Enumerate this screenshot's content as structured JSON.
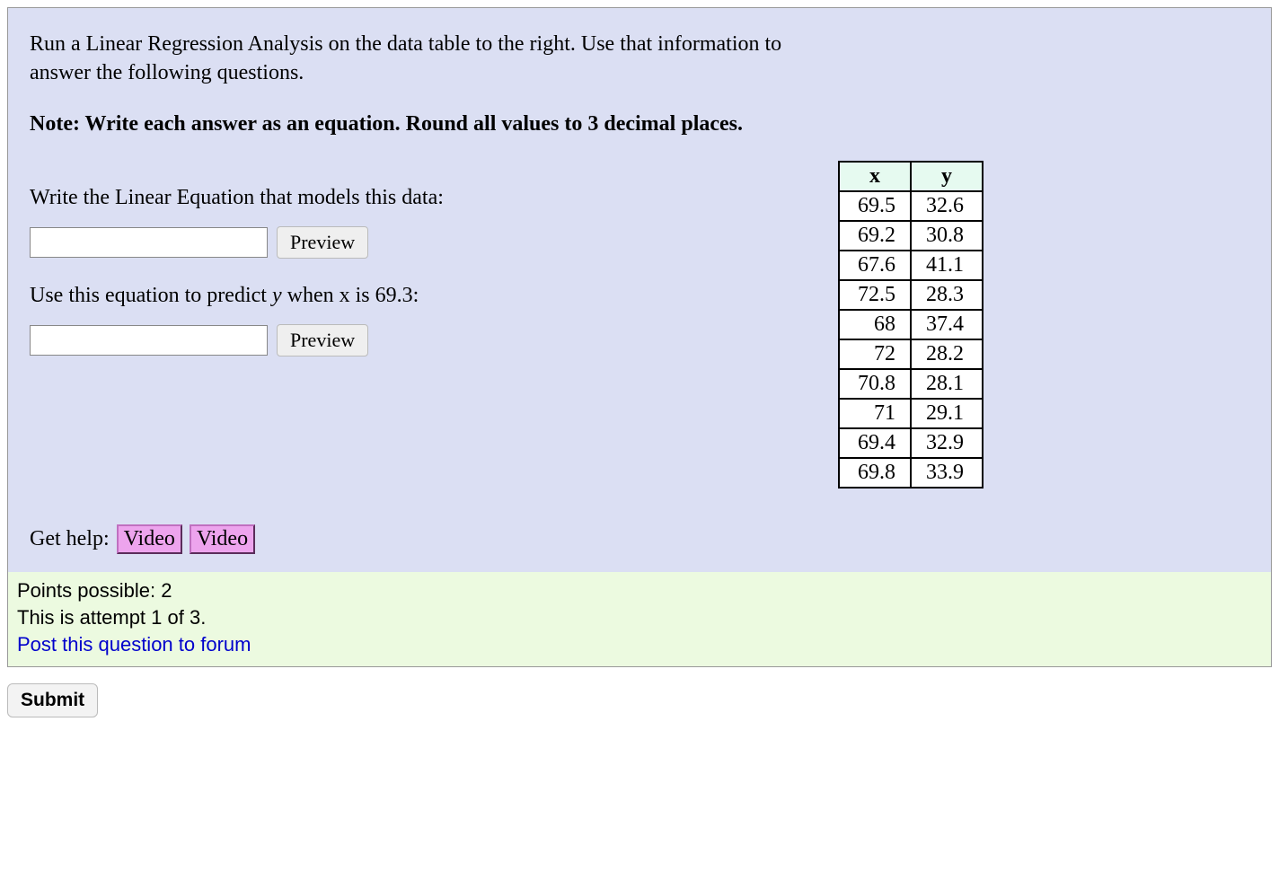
{
  "intro": "Run a Linear Regression Analysis on the data table to the right. Use that information to answer the following questions.",
  "note": "Note: Write each answer as an equation. Round all values to 3 decimal places.",
  "q1": {
    "prompt": "Write the Linear Equation that models this data:",
    "preview": "Preview"
  },
  "q2": {
    "prompt_pre": "Use this equation to predict ",
    "prompt_var": "y",
    "prompt_post": " when x is 69.3:",
    "preview": "Preview"
  },
  "table": {
    "headers": {
      "x": "x",
      "y": "y"
    },
    "rows": [
      {
        "x": "69.5",
        "y": "32.6"
      },
      {
        "x": "69.2",
        "y": "30.8"
      },
      {
        "x": "67.6",
        "y": "41.1"
      },
      {
        "x": "72.5",
        "y": "28.3"
      },
      {
        "x": "68",
        "y": "37.4"
      },
      {
        "x": "72",
        "y": "28.2"
      },
      {
        "x": "70.8",
        "y": "28.1"
      },
      {
        "x": "71",
        "y": "29.1"
      },
      {
        "x": "69.4",
        "y": "32.9"
      },
      {
        "x": "69.8",
        "y": "33.9"
      }
    ]
  },
  "help": {
    "label": "Get help:",
    "video1": "Video",
    "video2": "Video"
  },
  "footer": {
    "points": "Points possible: 2",
    "attempt": "This is attempt 1 of 3.",
    "forum": "Post this question to forum"
  },
  "submit": "Submit"
}
